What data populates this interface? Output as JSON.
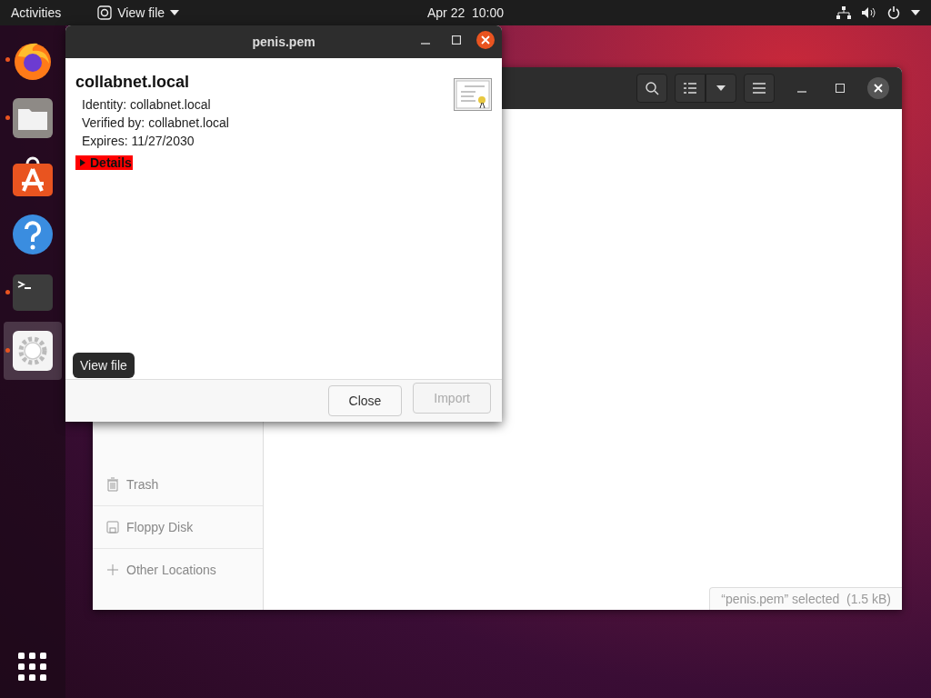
{
  "top_bar": {
    "activities": "Activities",
    "app_menu": "View file",
    "clock": "Apr 22  10:00"
  },
  "dock": {
    "items": [
      {
        "kind": "firefox",
        "running": true,
        "selected": false
      },
      {
        "kind": "files",
        "running": true,
        "selected": false
      },
      {
        "kind": "software",
        "running": false,
        "selected": false
      },
      {
        "kind": "help",
        "running": false,
        "selected": false
      },
      {
        "kind": "terminal",
        "running": true,
        "selected": false
      },
      {
        "kind": "viewer",
        "running": true,
        "selected": true
      }
    ],
    "tooltip": "View file"
  },
  "files_window": {
    "sidebar": {
      "items": [
        {
          "kind": "trash",
          "label": "Trash"
        },
        {
          "kind": "floppy",
          "label": "Floppy Disk"
        },
        {
          "kind": "other",
          "label": "Other Locations"
        }
      ]
    },
    "status": "“penis.pem” selected  (1.5 kB)"
  },
  "dialog": {
    "title": "penis.pem",
    "heading": "collabnet.local",
    "lines": [
      "Identity: collabnet.local",
      "Verified by: collabnet.local",
      "Expires: 11/27/2030"
    ],
    "details": {
      "label": "Details",
      "expanded": false
    },
    "buttons": [
      {
        "label": "Close",
        "disabled": false
      },
      {
        "label": "Import",
        "disabled": true
      }
    ]
  }
}
